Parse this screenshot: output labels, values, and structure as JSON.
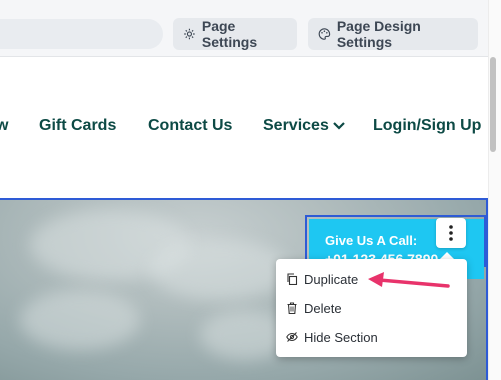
{
  "toolbar": {
    "page_settings_label": "Page Settings",
    "page_design_settings_label": "Page Design Settings"
  },
  "nav": {
    "partial_label": "w",
    "items": [
      "Gift Cards",
      "Contact Us",
      "Services",
      "Login/Sign Up"
    ]
  },
  "cta": {
    "title": "Give Us A Call:",
    "phone": "+01 123 456 7890"
  },
  "context_menu": {
    "items": [
      "Duplicate",
      "Delete",
      "Hide Section"
    ]
  },
  "colors": {
    "nav_text": "#0d4a45",
    "cta_bg": "#1ec7f2",
    "selection_border": "#2e5bd6",
    "annotation_arrow": "#e8336b"
  }
}
